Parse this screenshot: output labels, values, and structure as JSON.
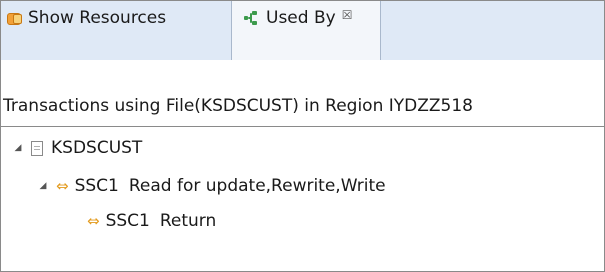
{
  "tabs": [
    {
      "label": "Show Resources",
      "icon": "show-resources-icon",
      "active": false
    },
    {
      "label": "Used By",
      "icon": "used-by-icon",
      "active": true,
      "close": "☒"
    }
  ],
  "summary": "Transactions using File(KSDSCUST) in Region IYDZZ518",
  "tree": {
    "root": {
      "label": "KSDSCUST",
      "expanded": true
    },
    "children": [
      {
        "id": "SSC1",
        "ops": "Read for update,Rewrite,Write",
        "expanded": true
      },
      {
        "id": "SSC1",
        "ops": "Return"
      }
    ]
  },
  "glyphs": {
    "expanded": "◢",
    "transfer": "⇔"
  }
}
